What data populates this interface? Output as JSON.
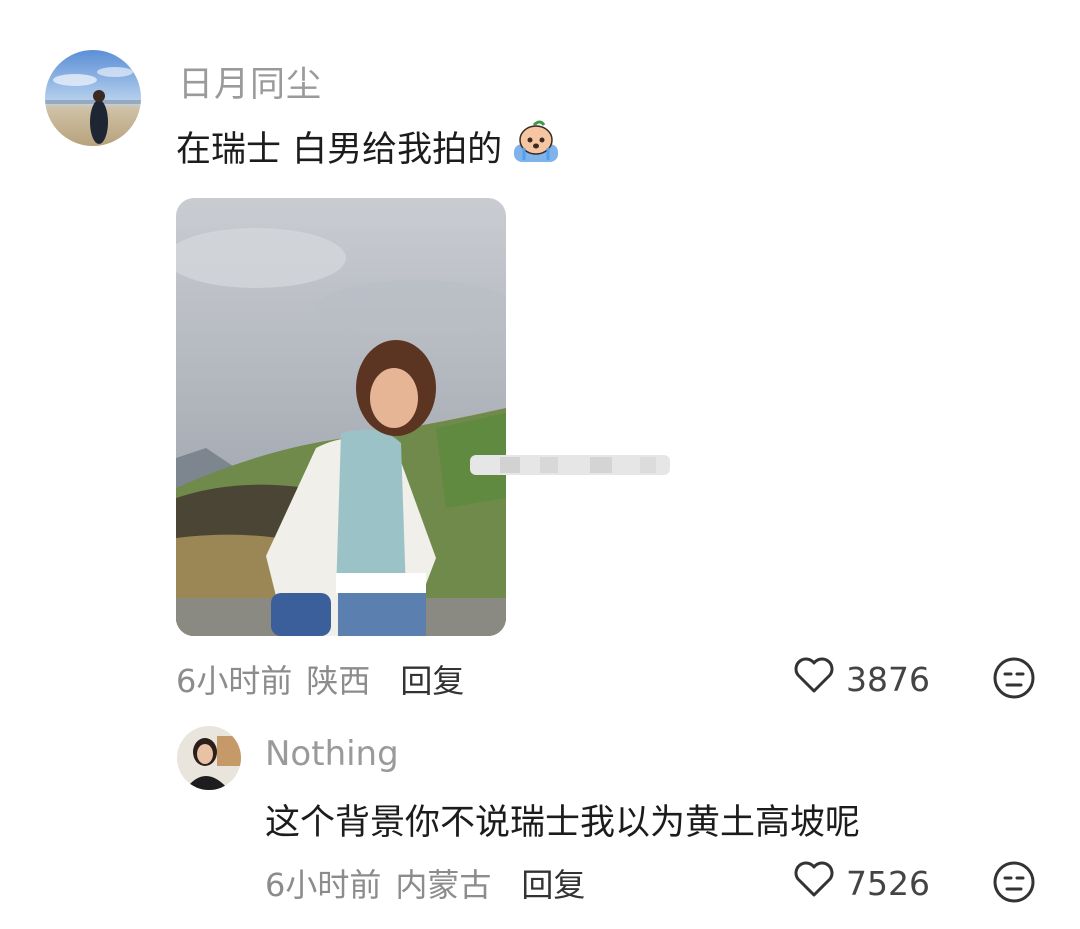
{
  "comment": {
    "username": "日月同尘",
    "text": "在瑞士 白男给我拍的",
    "emoji_icon": "crying-face-emoji-icon",
    "time": "6小时前",
    "location": "陕西",
    "reply_label": "回复",
    "likes": "3876"
  },
  "reply": {
    "username": "Nothing",
    "text": "这个背景你不说瑞士我以为黄土高坡呢",
    "time": "6小时前",
    "location": "内蒙古",
    "reply_label": "回复",
    "likes": "7526"
  },
  "colors": {
    "meta_gray": "#8c8c8c",
    "name_gray": "#9a9a9a",
    "text_dark": "#1c1c1c"
  }
}
